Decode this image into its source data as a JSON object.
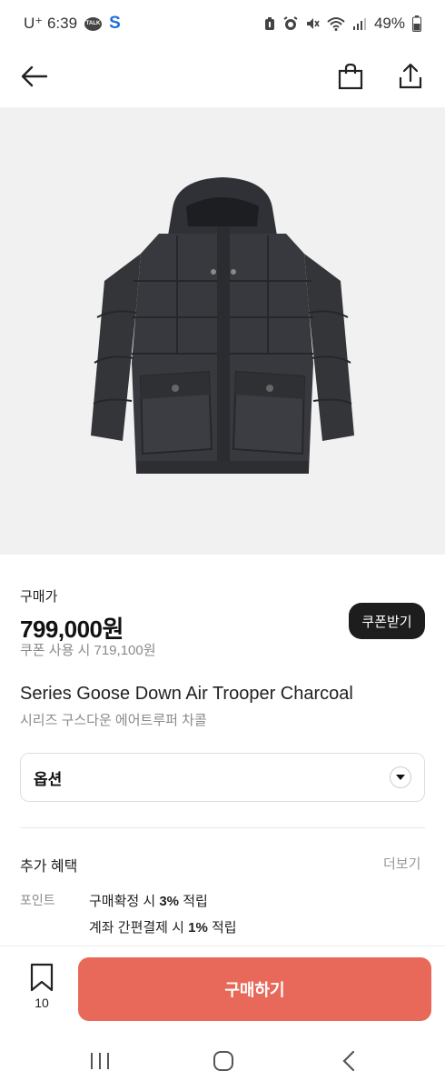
{
  "status_bar": {
    "carrier": "U⁺ 6:39",
    "talk_label": "TALK",
    "s_label": "S",
    "battery": "49%"
  },
  "product": {
    "price_label": "구매가",
    "price": "799,000원",
    "coupon_price": "쿠폰 사용 시 719,100원",
    "coupon_button": "쿠폰받기",
    "name_en": "Series Goose Down Air Trooper Charcoal",
    "name_ko": "시리즈 구스다운 에어트루퍼 차콜"
  },
  "option": {
    "label": "옵션"
  },
  "benefits": {
    "title": "추가 혜택",
    "more": "더보기",
    "point_label": "포인트",
    "lines": [
      {
        "pre": "구매확정 시 ",
        "bold": "3%",
        "post": " 적립"
      },
      {
        "pre": "계좌 간편결제 시 ",
        "bold": "1%",
        "post": " 적립"
      }
    ]
  },
  "bottom_bar": {
    "wish_count": "10",
    "buy_label": "구매하기"
  },
  "colors": {
    "buy_button": "#e8695a",
    "coupon_button": "#1d1d1d"
  },
  "icons": [
    "back-arrow-icon",
    "shopping-bag-icon",
    "share-icon",
    "bookmark-icon",
    "chevron-down-icon",
    "recents-icon",
    "home-icon",
    "nav-back-icon"
  ]
}
